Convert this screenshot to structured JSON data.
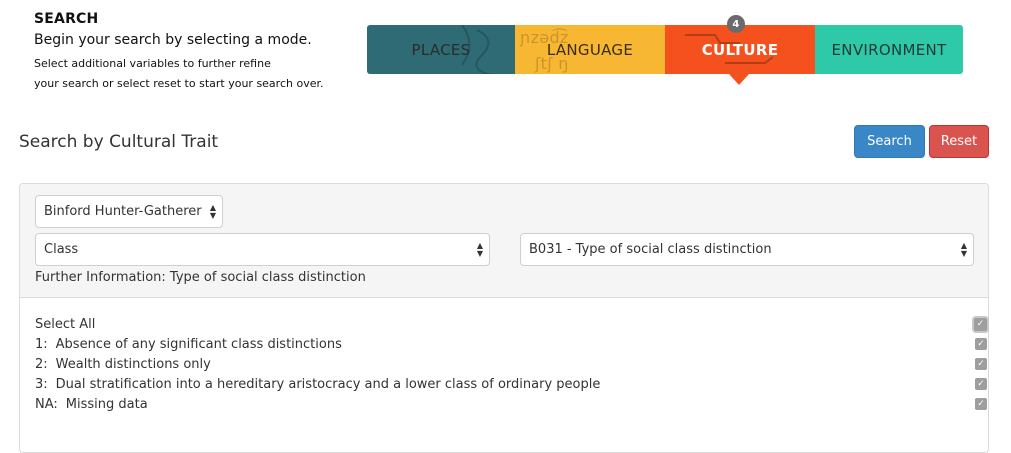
{
  "intro": {
    "heading": "SEARCH",
    "lead": "Begin your search by selecting a mode.",
    "line1": "Select additional variables to further refine",
    "line2": "your search or select reset to start your search over."
  },
  "tabs": [
    {
      "label": "PLACES"
    },
    {
      "label": "LANGUAGE"
    },
    {
      "label": "CULTURE",
      "badge": "4"
    },
    {
      "label": "ENVIRONMENT"
    }
  ],
  "colors": {
    "places": "#2f6b74",
    "language": "#f7b733",
    "culture": "#f4511e",
    "environment": "#2ec9a8",
    "search_button": "#3a87c8",
    "reset_button": "#d9534f"
  },
  "section": {
    "title": "Search by Cultural Trait",
    "search_label": "Search",
    "reset_label": "Reset"
  },
  "filters": {
    "dataset": "Binford Hunter-Gatherer",
    "category": "Class",
    "variable": "B031 - Type of social class distinction",
    "further_info": "Further Information: Type of social class distinction"
  },
  "options": {
    "select_all_label": "Select All",
    "items": [
      {
        "code": "1:",
        "label": "Absence of any significant class distinctions",
        "checked": true
      },
      {
        "code": "2:",
        "label": "Wealth distinctions only",
        "checked": true
      },
      {
        "code": "3:",
        "label": "Dual stratification into a hereditary aristocracy and a lower class of ordinary people",
        "checked": true
      },
      {
        "code": "NA:",
        "label": "Missing data",
        "checked": true
      }
    ]
  }
}
